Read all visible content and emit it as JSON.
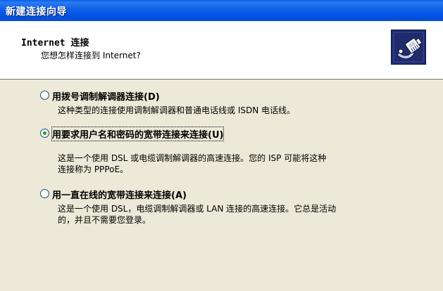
{
  "window": {
    "title": "新建连接向导"
  },
  "header": {
    "title": "Internet 连接",
    "subtitle": "您想怎样连接到 Internet?",
    "icon": "network-cable-icon"
  },
  "options": [
    {
      "label": "用拨号调制解调器连接(D)",
      "selected": false,
      "description_lines": [
        "这种类型的连接使用调制解调器和普通电话线或 ISDN 电话线。"
      ]
    },
    {
      "label": "用要求用户名和密码的宽带连接来连接(U)",
      "selected": true,
      "description_lines": [
        "这是一个使用 DSL 或电缆调制解调器的高速连接。您的 ISP 可能将这种",
        "连接称为 PPPoE。"
      ]
    },
    {
      "label": "用一直在线的宽带连接来连接(A)",
      "selected": false,
      "description_lines": [
        "这是一个使用 DSL，电缆调制解调器或 LAN 连接的高速连接。它总是活动",
        "的，并且不需要您登录。"
      ]
    }
  ],
  "colors": {
    "titlebar": "#0054e3",
    "dialog_background": "#ece9d8",
    "radio_selected": "#21a121"
  }
}
